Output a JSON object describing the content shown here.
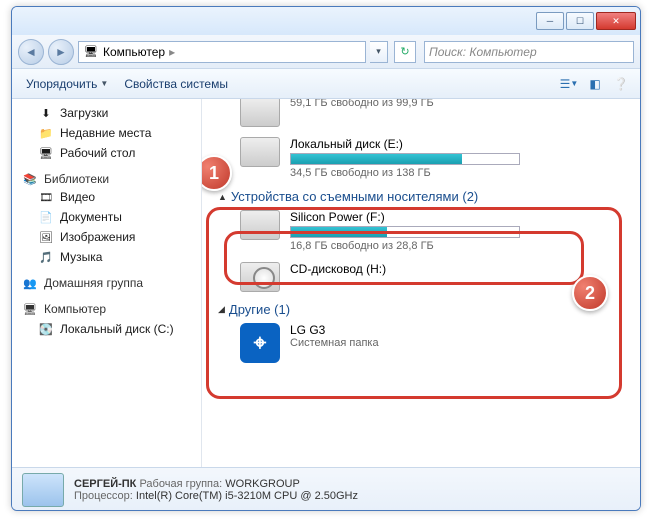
{
  "window": {
    "title": "Компьютер"
  },
  "address": {
    "location": "Компьютер",
    "arrow": "▸"
  },
  "search": {
    "placeholder": "Поиск: Компьютер"
  },
  "toolbar": {
    "organize": "Упорядочить",
    "props": "Свойства системы"
  },
  "sidebar": {
    "downloads": "Загрузки",
    "recent": "Недавние места",
    "desktop": "Рабочий стол",
    "libraries_hdr": "Библиотеки",
    "video": "Видео",
    "documents": "Документы",
    "pictures": "Изображения",
    "music": "Музыка",
    "homegroup_hdr": "Домашняя группа",
    "computer_hdr": "Компьютер",
    "localc": "Локальный диск (C:)"
  },
  "content": {
    "drive0_stat": "59,1 ГБ свободно из 99,9 ГБ",
    "drive_e_label": "Локальный диск (E:)",
    "drive_e_stat": "34,5 ГБ свободно из 138 ГБ",
    "group_removable": "Устройства со съемными носителями (2)",
    "drive_f_label": "Silicon Power (F:)",
    "drive_f_stat": "16,8 ГБ свободно из 28,8 ГБ",
    "drive_h_label": "CD-дисковод (H:)",
    "group_other": "Другие (1)",
    "lg_label": "LG G3",
    "lg_sub": "Системная папка"
  },
  "status": {
    "pcname": "СЕРГЕЙ-ПК",
    "workgroup_lbl": "Рабочая группа:",
    "workgroup_val": "WORKGROUP",
    "cpu_lbl": "Процессор:",
    "cpu_val": "Intel(R) Core(TM) i5-3210M CPU @ 2.50GHz"
  },
  "badges": {
    "one": "1",
    "two": "2"
  }
}
